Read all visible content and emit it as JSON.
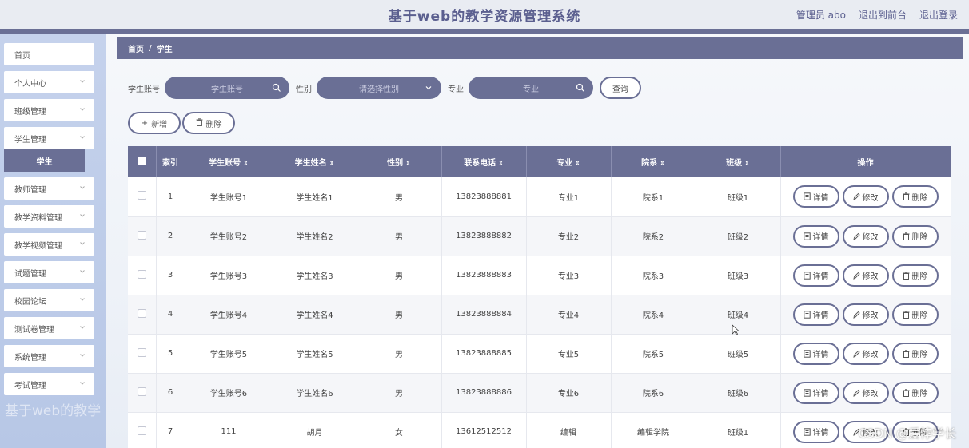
{
  "header": {
    "title": "基于web的教学资源管理系统",
    "user_label": "管理员 abo",
    "front_label": "退出到前台",
    "logout_label": "退出登录"
  },
  "sidebar": {
    "items": [
      {
        "label": "首页",
        "has_chevron": false
      },
      {
        "label": "个人中心",
        "has_chevron": true
      },
      {
        "label": "班级管理",
        "has_chevron": true
      },
      {
        "label": "学生管理",
        "has_chevron": true
      },
      {
        "label": "教师管理",
        "has_chevron": true
      },
      {
        "label": "教学资料管理",
        "has_chevron": true
      },
      {
        "label": "教学视频管理",
        "has_chevron": true
      },
      {
        "label": "试题管理",
        "has_chevron": true
      },
      {
        "label": "校园论坛",
        "has_chevron": true
      },
      {
        "label": "测试卷管理",
        "has_chevron": true
      },
      {
        "label": "系统管理",
        "has_chevron": true
      },
      {
        "label": "考试管理",
        "has_chevron": true
      }
    ],
    "active_sub": "学生",
    "watermark": "基于web的教学"
  },
  "breadcrumb": {
    "home": "首页",
    "sep": "/",
    "current": "学生"
  },
  "search": {
    "account_label": "学生账号",
    "account_placeholder": "学生账号",
    "gender_label": "性别",
    "gender_placeholder": "请选择性别",
    "major_label": "专业",
    "major_placeholder": "专业",
    "query_label": "查询"
  },
  "actions": {
    "add_label": "新增",
    "delete_label": "删除"
  },
  "table": {
    "columns": [
      "索引",
      "学生账号",
      "学生姓名",
      "性别",
      "联系电话",
      "专业",
      "院系",
      "班级",
      "操作"
    ],
    "rows": [
      [
        "1",
        "学生账号1",
        "学生姓名1",
        "男",
        "13823888881",
        "专业1",
        "院系1",
        "班级1"
      ],
      [
        "2",
        "学生账号2",
        "学生姓名2",
        "男",
        "13823888882",
        "专业2",
        "院系2",
        "班级2"
      ],
      [
        "3",
        "学生账号3",
        "学生姓名3",
        "男",
        "13823888883",
        "专业3",
        "院系3",
        "班级3"
      ],
      [
        "4",
        "学生账号4",
        "学生姓名4",
        "男",
        "13823888884",
        "专业4",
        "院系4",
        "班级4"
      ],
      [
        "5",
        "学生账号5",
        "学生姓名5",
        "男",
        "13823888885",
        "专业5",
        "院系5",
        "班级5"
      ],
      [
        "6",
        "学生账号6",
        "学生姓名6",
        "男",
        "13823888886",
        "专业6",
        "院系6",
        "班级6"
      ],
      [
        "7",
        "111",
        "胡月",
        "女",
        "13612512512",
        "编辑",
        "编辑学院",
        "班级1"
      ]
    ],
    "op_labels": {
      "detail": "详情",
      "edit": "修改",
      "delete": "删除"
    }
  },
  "watermark_csdn": "CSDN @爱悖学长",
  "colors": {
    "accent": "#6a6f95",
    "title": "#5b5f8f",
    "sidebar": "#c5d2ec"
  }
}
